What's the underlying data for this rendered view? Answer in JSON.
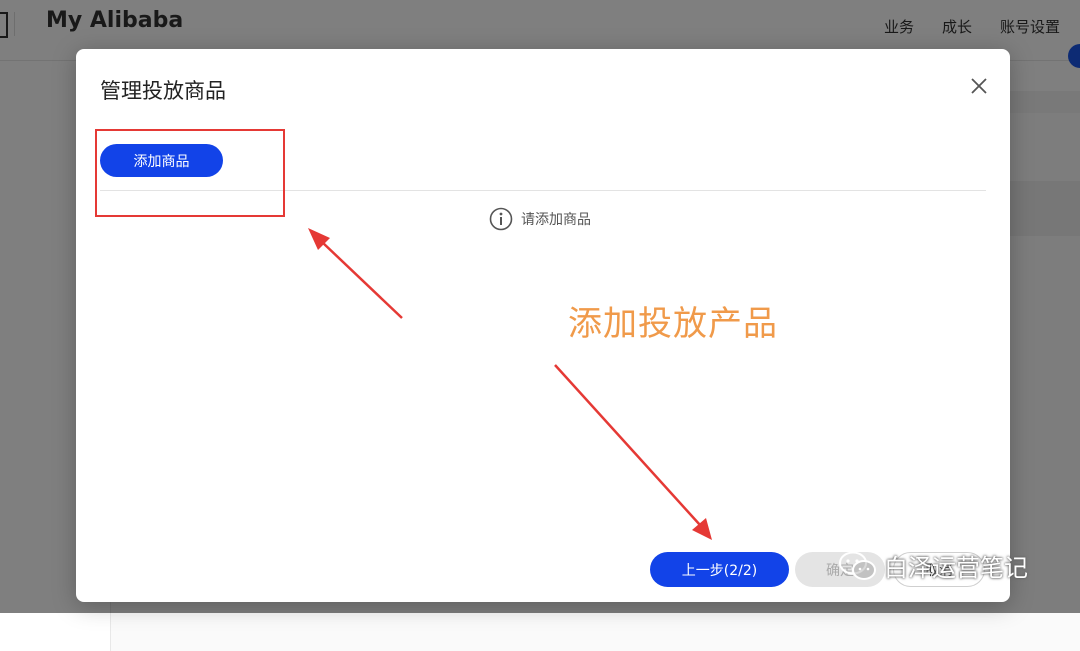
{
  "header": {
    "brand_title": "My Alibaba",
    "nav": [
      "业务",
      "成长",
      "账号设置"
    ]
  },
  "modal": {
    "title": "管理投放商品",
    "add_button": "添加商品",
    "empty_hint": "请添加商品",
    "prev_button": "上一步(2/2)",
    "confirm_button": "确定",
    "cancel_button": "取消"
  },
  "annotation": {
    "label": "添加投放产品",
    "label_color": "#f09a4a",
    "box_color": "#e53935"
  },
  "watermark": {
    "text": "白泽运营笔记",
    "icon": "wechat-icon"
  },
  "colors": {
    "primary": "#1243e8",
    "overlay": "rgba(0,0,0,0.5)"
  }
}
